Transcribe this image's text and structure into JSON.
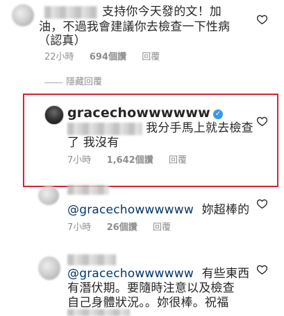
{
  "comments": [
    {
      "text_line1": "支持你今天發的文！加",
      "text_line2": "油，不過我會建議你去檢查一下性病",
      "text_line3": "（認真）",
      "time": "22小時",
      "likes": "694個讚",
      "reply": "回覆"
    },
    {
      "hidden_replies": "隱藏回覆"
    },
    {
      "username": "gracechowwwwww",
      "verified": "✓",
      "text_line1": "我分手馬上就去檢查",
      "text_line2": "了 我沒有",
      "time": "7小時",
      "likes": "1,642個讚",
      "reply": "回覆"
    },
    {
      "mention": "@gracechowwwwww",
      "text": "妳超棒的",
      "time": "7小時",
      "likes": "26個讚",
      "reply": "回覆"
    },
    {
      "mention": "@gracechowwwwww",
      "text_line1": "有些東西",
      "text_line2": "有潛伏期。要隨時注意以及檢查",
      "text_line3": "自己身體狀況。。妳很棒。祝福"
    }
  ],
  "colors": {
    "highlight_border": "#d32333",
    "verified_badge": "#3897f0",
    "mention": "#00376b",
    "meta": "#8e8e8e"
  },
  "icons": [
    "heart-icon",
    "verified-icon"
  ]
}
